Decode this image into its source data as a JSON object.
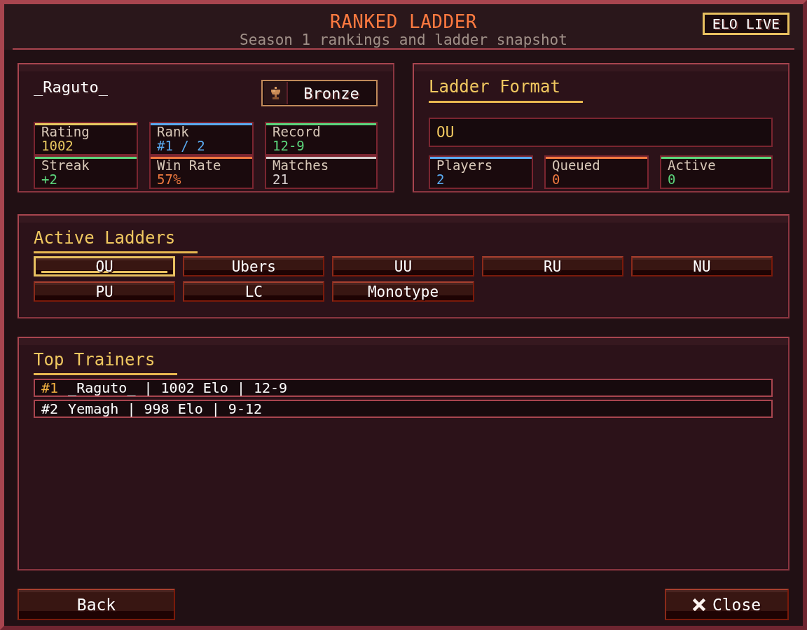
{
  "window": {
    "title": "RANKED LADDER",
    "subtitle": "Season 1 rankings and ladder snapshot",
    "badge": "ELO LIVE"
  },
  "player": {
    "name": "_Raguto_",
    "tier": "Bronze",
    "stats": [
      {
        "label": "Rating",
        "value": "1002",
        "color": "#e8c860"
      },
      {
        "label": "Rank",
        "value": "#1 / 2",
        "color": "#5aaaf0"
      },
      {
        "label": "Record",
        "value": "12-9",
        "color": "#5cd67c"
      },
      {
        "label": "Streak",
        "value": "+2",
        "color": "#5cd67c"
      },
      {
        "label": "Win Rate",
        "value": "57%",
        "color": "#f07a40"
      },
      {
        "label": "Matches",
        "value": "21",
        "color": "#d8d0d0"
      }
    ]
  },
  "ladder_format": {
    "title": "Ladder Format",
    "value": "OU",
    "stats": [
      {
        "label": "Players",
        "value": "2",
        "color": "#5aaaf0"
      },
      {
        "label": "Queued",
        "value": "0",
        "color": "#f07a40"
      },
      {
        "label": "Active",
        "value": "0",
        "color": "#5cd67c"
      }
    ]
  },
  "active_ladders": {
    "title": "Active Ladders",
    "items": [
      {
        "label": "OU",
        "selected": true
      },
      {
        "label": "Ubers",
        "selected": false
      },
      {
        "label": "UU",
        "selected": false
      },
      {
        "label": "RU",
        "selected": false
      },
      {
        "label": "NU",
        "selected": false
      },
      {
        "label": "PU",
        "selected": false
      },
      {
        "label": "LC",
        "selected": false
      },
      {
        "label": "Monotype",
        "selected": false
      }
    ]
  },
  "top_trainers": {
    "title": "Top Trainers",
    "rows": [
      {
        "rank": "#1",
        "text": "_Raguto_ | 1002 Elo | 12-9",
        "highlighted": true
      },
      {
        "rank": "#2",
        "text": "Yemagh | 998 Elo | 9-12",
        "highlighted": false
      }
    ]
  },
  "buttons": [
    {
      "label": "Back",
      "kind": "back"
    },
    {
      "label": "Close",
      "kind": "close"
    }
  ]
}
